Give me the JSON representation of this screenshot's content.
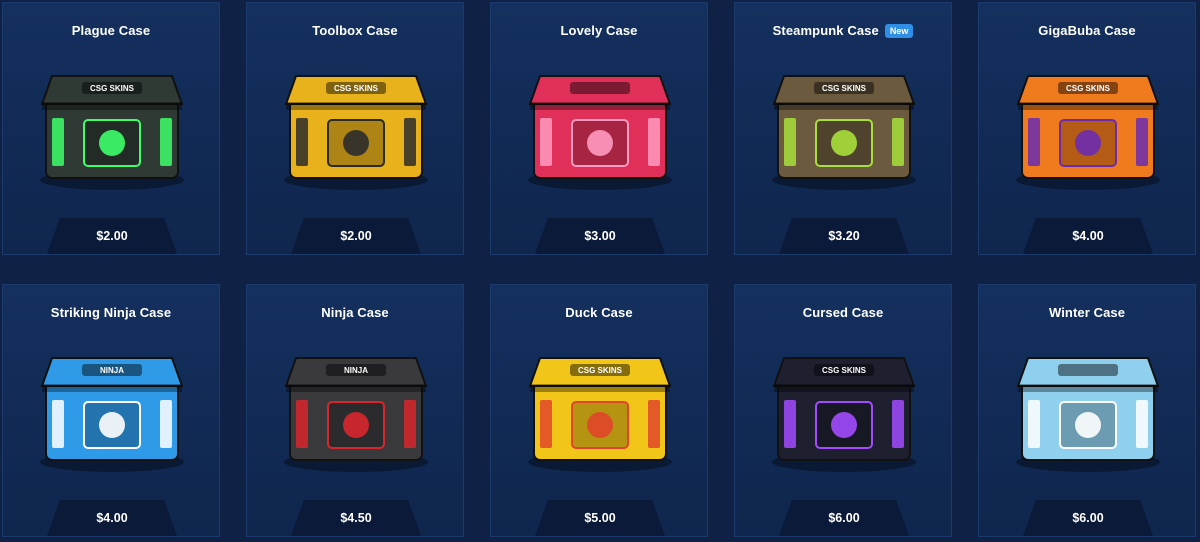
{
  "colors": {
    "background": "#0f2246",
    "card": "#14305e",
    "price_tab": "#0b1a38",
    "new_badge": "#2f8fe6"
  },
  "cases": [
    {
      "name": "Plague Case",
      "price": "$2.00",
      "icon": "plague-case-chest-icon",
      "color": "#2e3a33",
      "accent": "#3dff6a",
      "logo": "CSG SKINS"
    },
    {
      "name": "Toolbox Case",
      "price": "$2.00",
      "icon": "toolbox-case-chest-icon",
      "color": "#e8b21c",
      "accent": "#2b2b2b",
      "logo": "CSG SKINS"
    },
    {
      "name": "Lovely Case",
      "price": "$3.00",
      "icon": "lovely-case-chest-icon",
      "color": "#e0305a",
      "accent": "#ff9ac0",
      "logo": ""
    },
    {
      "name": "Steampunk Case",
      "price": "$3.20",
      "icon": "steampunk-case-chest-icon",
      "color": "#6b5a3e",
      "accent": "#a7e03a",
      "badge": "New",
      "logo": "CSG SKINS"
    },
    {
      "name": "GigaBuba Case",
      "price": "$4.00",
      "icon": "gigabuba-case-chest-icon",
      "color": "#f07a1e",
      "accent": "#6a2bb0",
      "logo": "CSG SKINS"
    },
    {
      "name": "Striking Ninja Case",
      "price": "$4.00",
      "icon": "striking-ninja-case-chest-icon",
      "color": "#2f9be8",
      "accent": "#ffffff",
      "logo": "NINJA"
    },
    {
      "name": "Ninja Case",
      "price": "$4.50",
      "icon": "ninja-case-chest-icon",
      "color": "#3a3a3c",
      "accent": "#d8262c",
      "logo": "NINJA"
    },
    {
      "name": "Duck Case",
      "price": "$5.00",
      "icon": "duck-case-chest-icon",
      "color": "#f2c619",
      "accent": "#e0452a",
      "logo": "CSG SKINS"
    },
    {
      "name": "Cursed Case",
      "price": "$6.00",
      "icon": "cursed-case-chest-icon",
      "color": "#1e2030",
      "accent": "#a24bff",
      "logo": "CSG SKINS"
    },
    {
      "name": "Winter Case",
      "price": "$6.00",
      "icon": "winter-case-chest-icon",
      "color": "#8fd0ee",
      "accent": "#ffffff",
      "logo": ""
    }
  ]
}
